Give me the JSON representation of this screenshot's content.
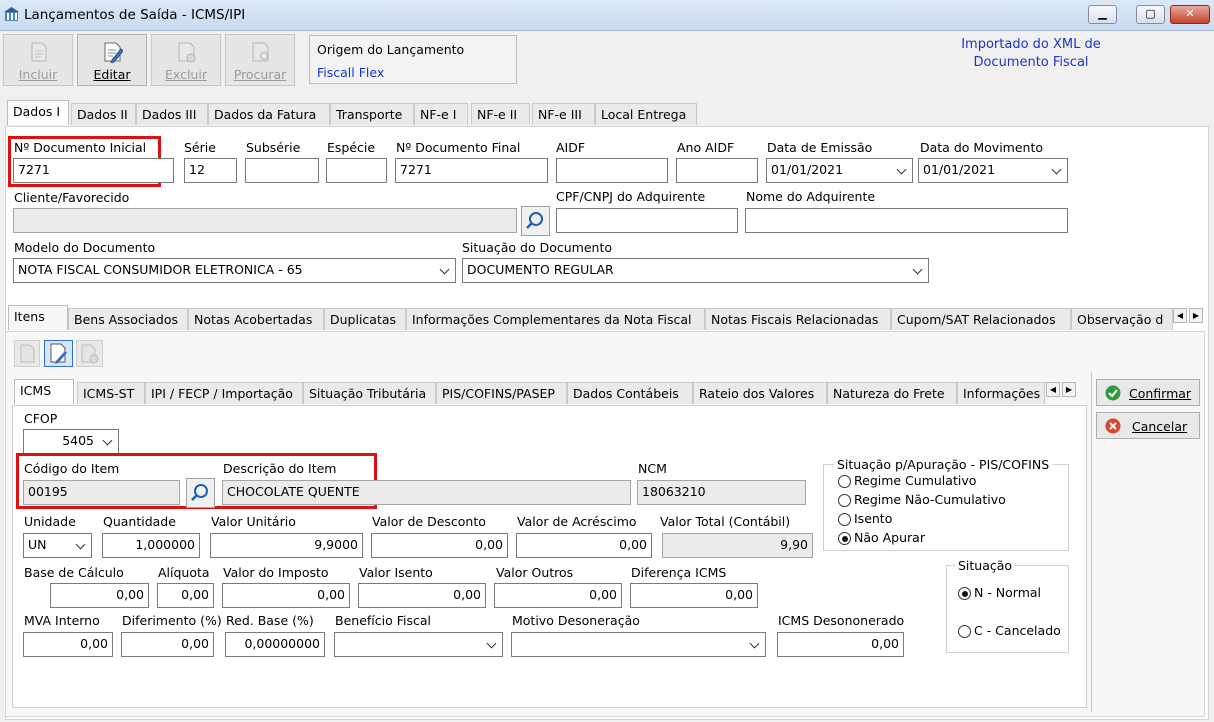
{
  "window": {
    "title": "Lançamentos de Saída - ICMS/IPI"
  },
  "toolbar": {
    "incluir": "Incluir",
    "editar": "Editar",
    "excluir": "Excluir",
    "procurar": "Procurar"
  },
  "origem": {
    "label": "Origem do Lançamento",
    "value": "Fiscall Flex"
  },
  "imported_note": {
    "line1": "Importado do XML de",
    "line2": "Documento Fiscal"
  },
  "main_tabs": [
    "Dados I",
    "Dados II",
    "Dados III",
    "Dados da Fatura",
    "Transporte",
    "NF-e I",
    "NF-e II",
    "NF-e III",
    "Local Entrega"
  ],
  "doc": {
    "num_inicial_label": "Nº Documento Inicial",
    "num_inicial": "7271",
    "serie_label": "Série",
    "serie": "12",
    "subserie_label": "Subsérie",
    "subserie": "",
    "especie_label": "Espécie",
    "especie": "",
    "num_final_label": "Nº Documento Final",
    "num_final": "7271",
    "aidf_label": "AIDF",
    "aidf": "",
    "ano_aidf_label": "Ano AIDF",
    "ano_aidf": "",
    "emissao_label": "Data de Emissão",
    "emissao": "01/01/2021",
    "movimento_label": "Data do Movimento",
    "movimento": "01/01/2021",
    "cliente_label": "Cliente/Favorecido",
    "cliente": "",
    "cpf_label": "CPF/CNPJ do Adquirente",
    "cpf": "",
    "nome_adq_label": "Nome do Adquirente",
    "nome_adq": "",
    "modelo_label": "Modelo do Documento",
    "modelo": "NOTA FISCAL CONSUMIDOR ELETRONICA - 65",
    "situacao_label": "Situação do Documento",
    "situacao": "DOCUMENTO REGULAR"
  },
  "sub_tabs": [
    "Itens",
    "Bens Associados",
    "Notas Acobertadas",
    "Duplicatas",
    "Informações Complementares da Nota Fiscal",
    "Notas Fiscais Relacionadas",
    "Cupom/SAT Relacionados",
    "Observação d"
  ],
  "item_tabs": [
    "ICMS",
    "ICMS-ST",
    "IPI / FECP / Importação",
    "Situação Tributária",
    "PIS/COFINS/PASEP",
    "Dados Contábeis",
    "Rateio dos Valores",
    "Natureza do Frete",
    "Informações"
  ],
  "item": {
    "cfop_label": "CFOP",
    "cfop": "5405",
    "codigo_label": "Código do Item",
    "codigo": "00195",
    "descricao_label": "Descrição do Item",
    "descricao": "CHOCOLATE QUENTE",
    "ncm_label": "NCM",
    "ncm": "18063210",
    "unidade_label": "Unidade",
    "unidade": "UN",
    "quantidade_label": "Quantidade",
    "quantidade": "1,000000",
    "valor_unit_label": "Valor Unitário",
    "valor_unit": "9,9000",
    "desconto_label": "Valor de Desconto",
    "desconto": "0,00",
    "acrescimo_label": "Valor de Acréscimo",
    "acrescimo": "0,00",
    "total_label": "Valor Total (Contábil)",
    "total": "9,90",
    "base_label": "Base de Cálculo",
    "base": "0,00",
    "aliquota_label": "Alíquota",
    "aliquota": "0,00",
    "imposto_label": "Valor do Imposto",
    "imposto": "0,00",
    "isento_label": "Valor Isento",
    "isento": "0,00",
    "outros_label": "Valor Outros",
    "outros": "0,00",
    "dif_label": "Diferença ICMS",
    "dif": "0,00",
    "mva_label": "MVA Interno",
    "mva": "0,00",
    "diferimento_label": "Diferimento (%)",
    "diferimento": "0,00",
    "redbase_label": "Red. Base (%)",
    "redbase": "0,00000000",
    "beneficio_label": "Benefício Fiscal",
    "beneficio": "",
    "motivo_label": "Motivo Desoneração",
    "motivo": "",
    "desonerado_label": "ICMS Desononerado",
    "desonerado": "0,00"
  },
  "pis_group": {
    "title": "Situação p/Apuração - PIS/COFINS",
    "options": [
      "Regime Cumulativo",
      "Regime Não-Cumulativo",
      "Isento",
      "Não Apurar"
    ],
    "selected": "Não Apurar"
  },
  "sit_group": {
    "title": "Situação",
    "options": [
      "N - Normal",
      "C - Cancelado"
    ],
    "selected": "N - Normal"
  },
  "actions": {
    "confirmar": "Confirmar",
    "cancelar": "Cancelar"
  }
}
